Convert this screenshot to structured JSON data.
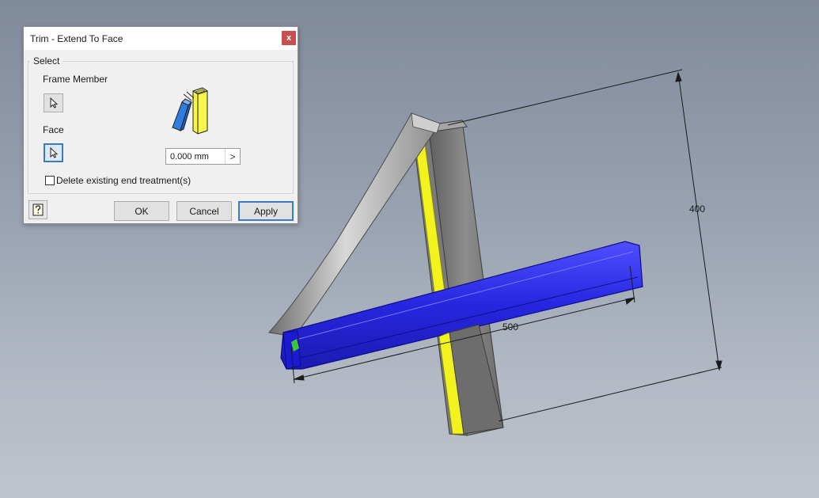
{
  "dialog": {
    "title": "Trim - Extend To Face",
    "close_glyph": "x",
    "group_label": "Select",
    "frame_member_label": "Frame Member",
    "face_label": "Face",
    "offset_value": "0.000 mm",
    "offset_arrow_glyph": ">",
    "delete_treatment_label": "Delete existing end treatment(s)",
    "delete_treatment_checked": false,
    "active_selector": "face",
    "ok_label": "OK",
    "cancel_label": "Cancel",
    "apply_label": "Apply",
    "help_icon": "help-question-icon",
    "select_icon": "cursor-arrow-icon"
  },
  "viewport": {
    "dimension_horizontal": "500",
    "dimension_vertical": "400",
    "colors": {
      "selected_member": "#2a2ae6",
      "highlight_face": "#f2f21e",
      "frame_steel": "#8a8a8a",
      "background_top": "#7f8a9b",
      "background_bottom": "#bfc4cc"
    }
  }
}
